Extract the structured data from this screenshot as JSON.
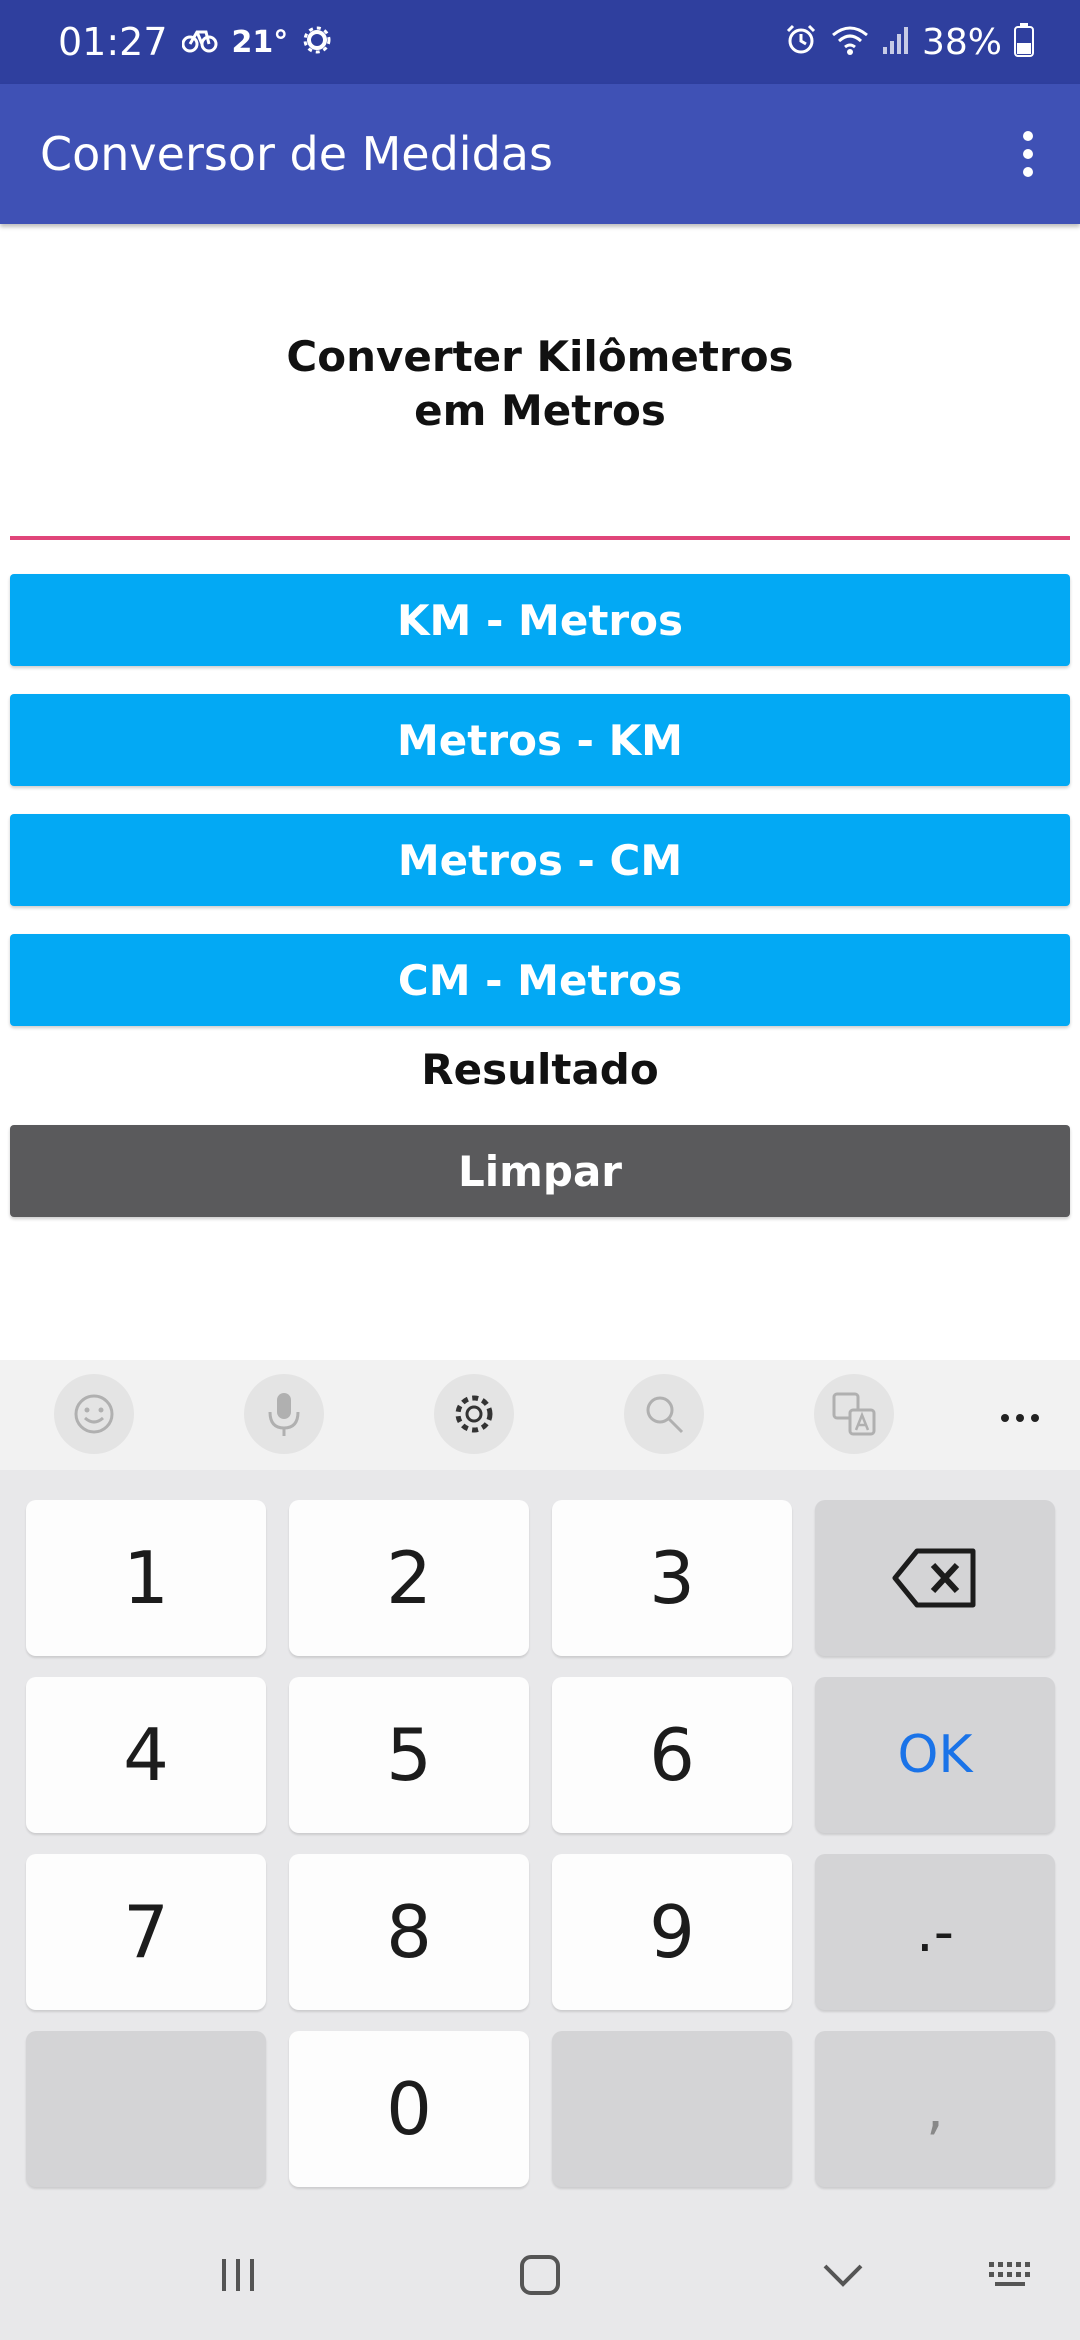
{
  "status_bar": {
    "time": "01:27",
    "temperature": "21°",
    "battery": "38%",
    "icons": [
      "bike-notification-icon",
      "settings-notification-icon",
      "alarm-icon",
      "wifi-icon",
      "signal-icon",
      "battery-icon"
    ]
  },
  "app_bar": {
    "title": "Conversor de Medidas",
    "menu_icon": "more-vert-icon"
  },
  "main": {
    "heading_line1": "Converter Kilômetros",
    "heading_line2": "em Metros",
    "input": {
      "value": "",
      "placeholder": ""
    },
    "buttons": [
      {
        "label": "KM - Metros"
      },
      {
        "label": "Metros - KM"
      },
      {
        "label": "Metros - CM"
      },
      {
        "label": "CM - Metros"
      }
    ],
    "result_label": "Resultado",
    "clear_label": "Limpar"
  },
  "keyboard_toolbar": {
    "icons": [
      "emoji-icon",
      "microphone-icon",
      "settings-icon",
      "search-icon",
      "translate-icon",
      "more-horiz-icon"
    ]
  },
  "keyboard": {
    "keys": {
      "k1": "1",
      "k2": "2",
      "k3": "3",
      "k4": "4",
      "k5": "5",
      "k6": "6",
      "k7": "7",
      "k8": "8",
      "k9": "9",
      "k0": "0",
      "ok": "OK",
      "dot_minus": ".-",
      "comma": ","
    }
  },
  "colors": {
    "status_bar": "#2f3f9e",
    "app_bar": "#3f51b5",
    "primary_button": "#03a9f4",
    "clear_button": "#5a5a5c",
    "input_underline": "#e0457a",
    "ok_key": "#1a73e8"
  }
}
